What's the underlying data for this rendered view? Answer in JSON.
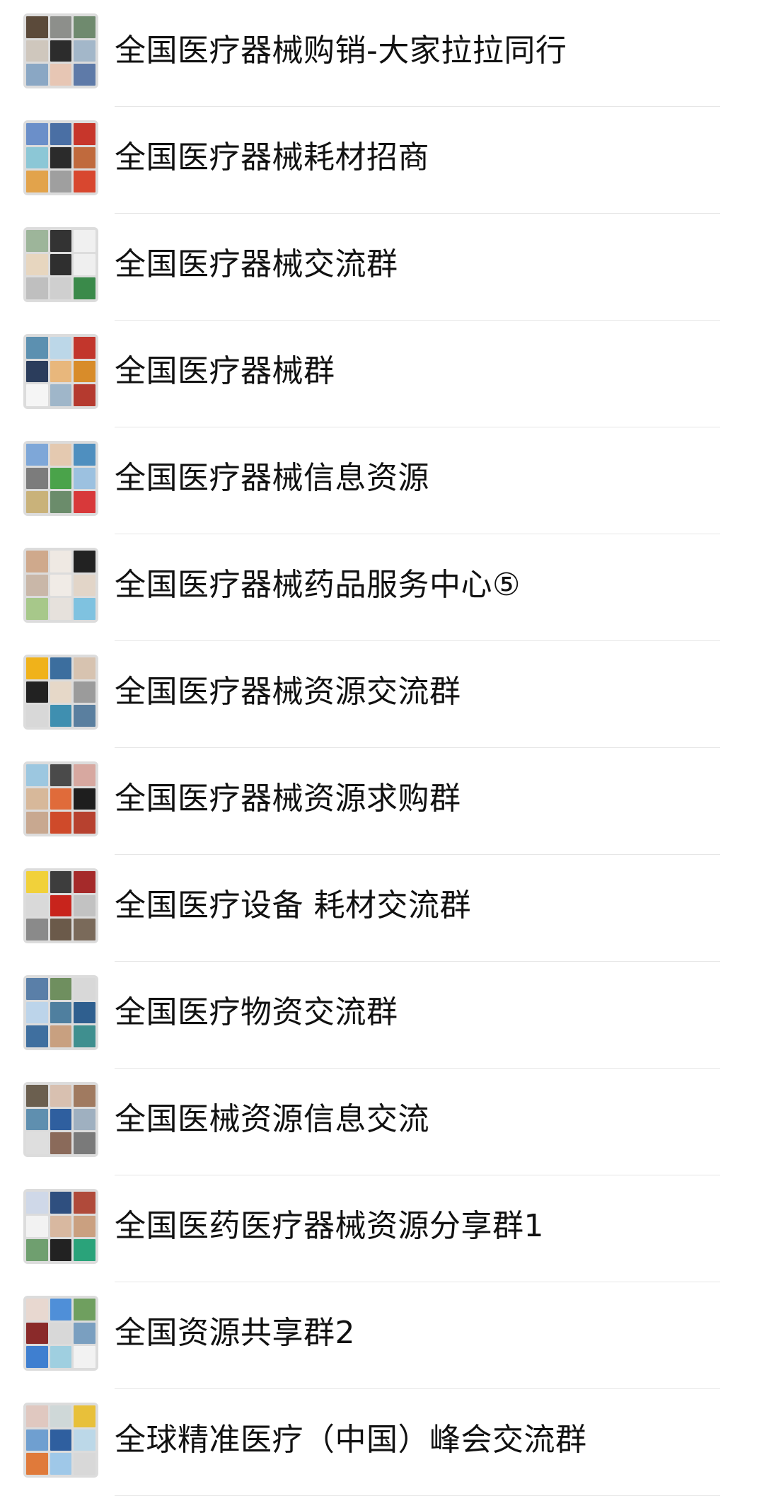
{
  "chats": [
    {
      "name": "全国医疗器械购销-大家拉拉同行",
      "tiles": [
        "#5b4a3a",
        "#8d8f8b",
        "#6f8a6e",
        "#cfc7bd",
        "#2c2c2c",
        "#a3b7c9",
        "#8aa7c4",
        "#e7c6b4",
        "#5e7aa8"
      ]
    },
    {
      "name": "全国医疗器械耗材招商",
      "tiles": [
        "#6b8fc9",
        "#4a6fa4",
        "#c7362b",
        "#8cc7d6",
        "#2b2b2b",
        "#c06a3d",
        "#e2a34b",
        "#9f9f9f",
        "#d8472f"
      ]
    },
    {
      "name": "全国医疗器械交流群",
      "tiles": [
        "#9db59a",
        "#333333",
        "#f0f0f0",
        "#e7d6bf",
        "#2f2f2f",
        "#efefef",
        "#bfbfbf",
        "#cfcfcf",
        "#3a8a4a"
      ]
    },
    {
      "name": "全国医疗器械群",
      "tiles": [
        "#5c90b0",
        "#bcd7e8",
        "#c2362c",
        "#2b3d5c",
        "#e8b77c",
        "#d88c2a",
        "#f5f5f5",
        "#9fb6c9",
        "#b53a2f"
      ]
    },
    {
      "name": "全国医疗器械信息资源",
      "tiles": [
        "#7ea7d8",
        "#e4c9b0",
        "#4f8fbf",
        "#7c7c7c",
        "#4aa34a",
        "#9cc1e0",
        "#c9b27a",
        "#6b8c6b",
        "#d8393a"
      ]
    },
    {
      "name": "全国医疗器械药品服务中心⑤",
      "tiles": [
        "#cfa98c",
        "#efe9e3",
        "#222222",
        "#c9b7a8",
        "#f0ebe6",
        "#e2d5c8",
        "#a7c88a",
        "#e6e1dc",
        "#7fc2e0"
      ]
    },
    {
      "name": "全国医疗器械资源交流群",
      "tiles": [
        "#f0b21a",
        "#3c6e9e",
        "#d7c3b0",
        "#222222",
        "#e6d8c8",
        "#9b9b9b",
        "#d8d8d8",
        "#3f8fb0",
        "#5a7f9f"
      ]
    },
    {
      "name": "全国医疗器械资源求购群",
      "tiles": [
        "#9cc7e0",
        "#4a4a4a",
        "#d7a8a0",
        "#d7b89a",
        "#e06b3a",
        "#1e1e1e",
        "#c8a890",
        "#cf4a2a",
        "#b7412f"
      ]
    },
    {
      "name": "全国医疗设备 耗材交流群",
      "tiles": [
        "#f1d13a",
        "#3d3d3d",
        "#a52a2a",
        "#d9d9d9",
        "#c8241c",
        "#c2c2c2",
        "#8a8a8a",
        "#6b5a4a",
        "#7a6a5a"
      ]
    },
    {
      "name": "全国医疗物资交流群",
      "tiles": [
        "#5a7fa8",
        "#6f8f5f",
        "#d8d8d8",
        "#bcd4ea",
        "#4f7f9f",
        "#2f5f8f",
        "#3f6f9f",
        "#c8a080",
        "#3f8f8f"
      ]
    },
    {
      "name": "全国医械资源信息交流",
      "tiles": [
        "#6b5f4f",
        "#d8c0b0",
        "#a07a60",
        "#5f8faf",
        "#2f5f9f",
        "#9fb0c0",
        "#dedede",
        "#8a6a5a",
        "#7a7a7a"
      ]
    },
    {
      "name": "全国医药医疗器械资源分享群1",
      "tiles": [
        "#cfd8e8",
        "#2f4f7f",
        "#b04a3a",
        "#f2f2f2",
        "#d8b8a0",
        "#caa080",
        "#6f9f6f",
        "#222222",
        "#2aa37a"
      ]
    },
    {
      "name": "全国资源共享群2",
      "tiles": [
        "#e8d8d0",
        "#4f8fd8",
        "#6f9f5f",
        "#8a2a2a",
        "#d8d8d8",
        "#7a9fc0",
        "#3f7fd0",
        "#9fcfe0",
        "#f2f2f2"
      ]
    },
    {
      "name": "全球精准医疗（中国）峰会交流群",
      "tiles": [
        "#e0c8c0",
        "#cfd8d8",
        "#e8c03a",
        "#6f9fd0",
        "#2f5f9f",
        "#bcd8e8",
        "#e07a3a",
        "#9fc8e8",
        "#d8d8d8"
      ]
    }
  ]
}
